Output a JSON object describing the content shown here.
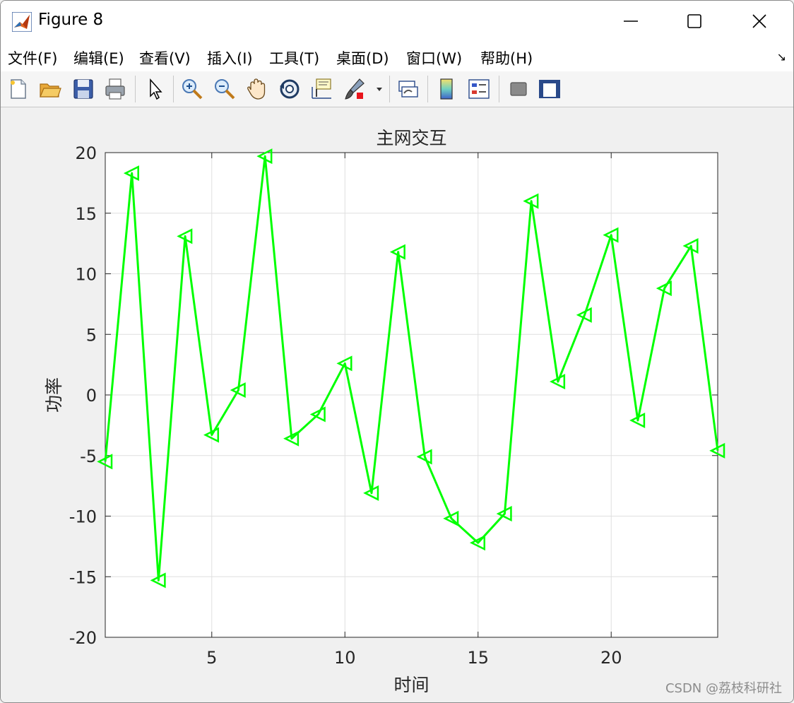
{
  "window": {
    "title": "Figure 8",
    "minimize_icon": "minimize-icon",
    "maximize_icon": "maximize-icon",
    "close_icon": "close-icon"
  },
  "menu": [
    "文件(F)",
    "编辑(E)",
    "查看(V)",
    "插入(I)",
    "工具(T)",
    "桌面(D)",
    "窗口(W)",
    "帮助(H)"
  ],
  "toolbar": {
    "icons": [
      "new-figure-icon",
      "open-file-icon",
      "save-icon",
      "print-icon",
      "pointer-icon",
      "zoom-in-icon",
      "zoom-out-icon",
      "pan-icon",
      "rotate-icon",
      "data-cursor-icon",
      "brush-icon",
      "link-plot-icon",
      "colorbar-icon",
      "legend-icon",
      "hide-plot-tools-icon",
      "show-plot-tools-icon"
    ]
  },
  "watermark": "CSDN @荔枝科研社",
  "chart_data": {
    "type": "line",
    "title": "主网交互",
    "xlabel": "时间",
    "ylabel": "功率",
    "xlim": [
      1,
      24
    ],
    "ylim": [
      -20,
      20
    ],
    "xticks": [
      5,
      10,
      15,
      20
    ],
    "yticks": [
      -20,
      -15,
      -10,
      -5,
      0,
      5,
      10,
      15,
      20
    ],
    "grid": true,
    "marker": "triangle-left",
    "series": [
      {
        "color": "#00ff00",
        "x": [
          1,
          2,
          3,
          4,
          5,
          6,
          7,
          8,
          9,
          10,
          11,
          12,
          13,
          14,
          15,
          16,
          17,
          18,
          19,
          20,
          21,
          22,
          23,
          24
        ],
        "values": [
          -5.5,
          18.3,
          -15.3,
          13.1,
          -3.3,
          0.4,
          19.7,
          -3.6,
          -1.6,
          2.6,
          -8.1,
          11.8,
          -5.1,
          -10.2,
          -12.2,
          -9.8,
          16.0,
          1.1,
          6.6,
          13.2,
          -2.1,
          8.8,
          12.3,
          -4.6
        ]
      }
    ]
  }
}
